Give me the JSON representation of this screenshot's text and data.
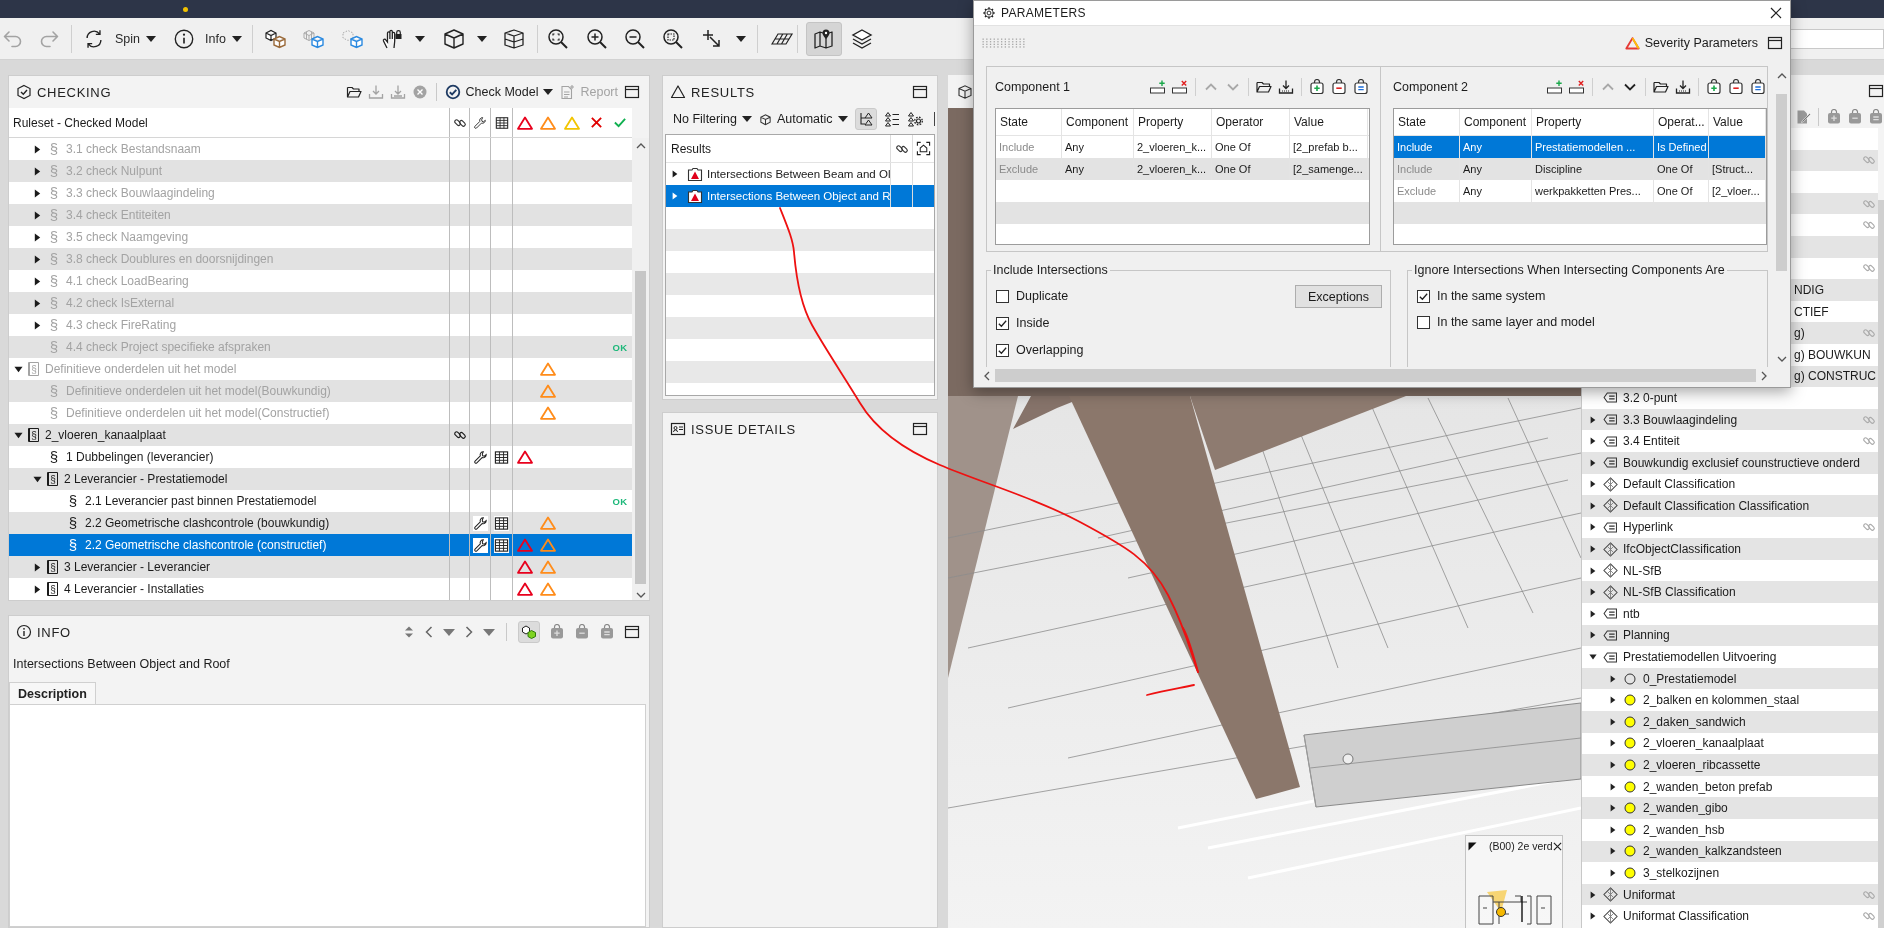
{
  "toolbar": {
    "undo": {
      "disabled": true
    },
    "redo": {
      "disabled": true
    },
    "spin": {
      "label": "Spin"
    },
    "info": {
      "label": "Info"
    },
    "map_view": {
      "active": true
    }
  },
  "checking": {
    "title": "CHECKING",
    "open_disabled": false,
    "import_disabled": true,
    "export_disabled": true,
    "stop_disabled": true,
    "check_model": "Check Model",
    "report": {
      "label": "Report",
      "disabled": true
    },
    "column_header": "Ruleset - Checked Model",
    "tree": [
      {
        "children": [
          {
            "kind": "rule",
            "symbol": "§",
            "label": "3.1 check Bestandsnaam",
            "enabled": false,
            "expanded": false,
            "selected": false
          },
          {
            "kind": "rule",
            "symbol": "§",
            "label": "3.2 check Nulpunt",
            "enabled": false,
            "expanded": false,
            "selected": false
          },
          {
            "kind": "rule",
            "symbol": "§",
            "label": "3.3 check Bouwlaagindeling",
            "enabled": false,
            "expanded": false,
            "selected": false
          },
          {
            "kind": "rule",
            "symbol": "§",
            "label": "3.4 check Entiteiten",
            "enabled": false,
            "expanded": false,
            "selected": false
          },
          {
            "kind": "rule",
            "symbol": "§",
            "label": "3.5 check Naamgeving",
            "enabled": false,
            "expanded": false,
            "selected": false
          },
          {
            "kind": "rule",
            "symbol": "§",
            "label": "3.8 check Doublures en doorsnijdingen",
            "enabled": false,
            "expanded": false,
            "selected": false
          },
          {
            "kind": "rule",
            "symbol": "§",
            "label": "4.1 check LoadBearing",
            "enabled": false,
            "expanded": false,
            "selected": false
          },
          {
            "kind": "rule",
            "symbol": "§",
            "label": "4.2 check IsExternal",
            "enabled": false,
            "expanded": false,
            "selected": false
          },
          {
            "kind": "rule",
            "symbol": "§",
            "label": "4.3 check FireRating",
            "enabled": false,
            "expanded": false,
            "selected": false
          },
          {
            "kind": "rule",
            "symbol": "§",
            "label": "4.4 check Project specifieke afspraken",
            "enabled": false,
            "selected": false,
            "status_text": "OK"
          }
        ]
      },
      {
        "kind": "ruleset",
        "symbol": "§",
        "label": "Definitieve onderdelen uit het model",
        "enabled": false,
        "expanded": true,
        "selected": false,
        "moderate": true,
        "children": [
          {
            "kind": "rule",
            "symbol": "§",
            "label": "Definitieve onderdelen uit het model(Bouwkundig)",
            "enabled": false,
            "selected": false,
            "moderate": true
          },
          {
            "kind": "rule",
            "symbol": "§",
            "label": "Definitieve onderdelen uit het model(Constructief)",
            "enabled": false,
            "selected": false,
            "moderate": true
          }
        ]
      },
      {
        "kind": "ruleset",
        "symbol": "§",
        "label": "2_vloeren_kanaalplaat",
        "enabled": true,
        "expanded": true,
        "selected": false,
        "link": true,
        "children": [
          {
            "kind": "rule",
            "symbol": "§",
            "label": "1 Dubbelingen (leverancier)",
            "enabled": true,
            "selected": false,
            "wrench": true,
            "table": true,
            "critical": true
          },
          {
            "kind": "ruleset",
            "symbol": "§",
            "label": "2 Leverancier - Prestatiemodel",
            "enabled": true,
            "expanded": true,
            "selected": false,
            "children": [
              {
                "kind": "rule",
                "symbol": "§",
                "label": "2.1 Leverancier past binnen Prestatiemodel",
                "enabled": true,
                "selected": false,
                "status_text": "OK"
              },
              {
                "kind": "rule",
                "symbol": "§",
                "label": "2.2 Geometrische clashcontrole (bouwkundig)",
                "enabled": true,
                "selected": false,
                "wrench": true,
                "table": true,
                "moderate": true
              },
              {
                "kind": "rule",
                "symbol": "§",
                "label": "2.2 Geometrische clashcontrole (constructief)",
                "enabled": true,
                "selected": true,
                "wrench": true,
                "table": true,
                "critical": true,
                "moderate": true
              }
            ]
          },
          {
            "kind": "ruleset",
            "symbol": "§",
            "label": "3 Leverancier - Leverancier",
            "enabled": true,
            "expanded": false,
            "selected": false,
            "critical": true,
            "moderate": true
          },
          {
            "kind": "ruleset",
            "symbol": "§",
            "label": "4 Leverancier - Installaties",
            "enabled": true,
            "expanded": false,
            "selected": false,
            "critical": true,
            "moderate": true
          }
        ]
      }
    ]
  },
  "info": {
    "title": "INFO",
    "show_model_active": true,
    "heading": "Intersections Between Object and Roof",
    "tabs": [
      {
        "label": "Description",
        "selected": true
      }
    ]
  },
  "results": {
    "title": "RESULTS",
    "filter": "No Filtering",
    "mode": "Automatic",
    "tree_view_active": true,
    "column_header": "Results",
    "rows": [
      {
        "label": "Intersections Between Beam and Ol",
        "expanded": false,
        "selected": false
      },
      {
        "label": "Intersections Between Object and R",
        "expanded": false,
        "selected": true
      }
    ]
  },
  "issue_details": {
    "title": "ISSUE DETAILS"
  },
  "viewport": {
    "view_label": "(B00) 2e verd"
  },
  "properties": {
    "covered_rows": [
      {},
      {
        "link": true
      },
      {},
      {
        "link": true
      },
      {
        "link": true
      },
      {},
      {
        "link": true
      },
      {
        "tail": "NDIG"
      },
      {
        "tail": "CTIEF"
      },
      {
        "tail": "g)",
        "link": true
      },
      {
        "tail": "g) BOUWKUN"
      },
      {
        "tail": "g) CONSTRUC"
      }
    ],
    "tree": [
      {
        "kind": "property",
        "label": "3.2 0-punt"
      },
      {
        "kind": "property",
        "label": "3.3 Bouwlaagindeling",
        "expanded": false,
        "link": true
      },
      {
        "kind": "property",
        "label": "3.4 Entiteit",
        "expanded": false,
        "link": true
      },
      {
        "kind": "property",
        "label": "Bouwkundig exclusief counstructieve onderd",
        "expanded": false
      },
      {
        "kind": "classification",
        "label": "Default Classification",
        "expanded": false
      },
      {
        "kind": "classification",
        "label": "Default Classification Classification",
        "expanded": false
      },
      {
        "kind": "property",
        "label": "Hyperlink",
        "expanded": false,
        "link": true
      },
      {
        "kind": "classification",
        "label": "IfcObjectClassification",
        "expanded": false
      },
      {
        "kind": "classification",
        "label": "NL-SfB",
        "expanded": false
      },
      {
        "kind": "classification",
        "label": "NL-SfB Classification",
        "expanded": false
      },
      {
        "kind": "property",
        "label": "ntb",
        "expanded": false
      },
      {
        "kind": "property",
        "label": "Planning",
        "expanded": false
      },
      {
        "kind": "property",
        "label": "Prestatiemodellen Uitvoering",
        "expanded": true,
        "children": [
          {
            "kind": "value",
            "label": "0_Prestatiemodel",
            "expanded": false
          },
          {
            "kind": "value",
            "label": "2_balken en kolommen_staal",
            "expanded": false,
            "color": "#ffff00"
          },
          {
            "kind": "value",
            "label": "2_daken_sandwich",
            "expanded": false,
            "color": "#ffff00"
          },
          {
            "kind": "value",
            "label": "2_vloeren_kanaalplaat",
            "expanded": false,
            "color": "#ffff00"
          },
          {
            "kind": "value",
            "label": "2_vloeren_ribcassette",
            "expanded": false,
            "color": "#ffff00"
          },
          {
            "kind": "value",
            "label": "2_wanden_beton prefab",
            "expanded": false,
            "color": "#ffff00"
          },
          {
            "kind": "value",
            "label": "2_wanden_gibo",
            "expanded": false,
            "color": "#ffff00"
          },
          {
            "kind": "value",
            "label": "2_wanden_hsb",
            "expanded": false,
            "color": "#ffff00"
          },
          {
            "kind": "value",
            "label": "2_wanden_kalkzandsteen",
            "expanded": false,
            "color": "#ffff00"
          },
          {
            "kind": "value",
            "label": "3_stelkozijnen",
            "expanded": false,
            "color": "#ffff00"
          }
        ]
      },
      {
        "kind": "classification",
        "label": "Uniformat",
        "expanded": false,
        "link": true
      },
      {
        "kind": "classification",
        "label": "Uniformat Classification",
        "expanded": false,
        "link": true
      }
    ]
  },
  "parameters_dialog": {
    "title": "PARAMETERS",
    "severity_label": "Severity Parameters",
    "components": [
      {
        "title": "Component 1",
        "move_up_enabled": false,
        "move_down_enabled": false,
        "columns": [
          "State",
          "Component",
          "Property",
          "Operator",
          "Value"
        ],
        "rows": [
          {
            "state": "Include",
            "component": "Any",
            "property": "2_vloeren_k...",
            "operator": "One Of",
            "value": "[2_prefab b...",
            "selected": false
          },
          {
            "state": "Exclude",
            "component": "Any",
            "property": "2_vloeren_k...",
            "operator": "One Of",
            "value": "[2_samenge...",
            "selected": false
          }
        ]
      },
      {
        "title": "Component 2",
        "move_up_enabled": false,
        "move_down_enabled": true,
        "columns": [
          "State",
          "Component",
          "Property",
          "Operat...",
          "Value"
        ],
        "rows": [
          {
            "state": "Include",
            "component": "Any",
            "property": "Prestatiemodellen ...",
            "operator": "Is Defined",
            "selected": true
          },
          {
            "state": "Include",
            "component": "Any",
            "property": "Discipline",
            "operator": "One Of",
            "value": "[Struct...",
            "selected": false
          },
          {
            "state": "Exclude",
            "component": "Any",
            "property": "werkpakketten Pres...",
            "operator": "One Of",
            "value": "[2_vloer...",
            "selected": false
          }
        ]
      }
    ],
    "include_intersections": {
      "title": "Include Intersections",
      "options": [
        {
          "label": "Duplicate",
          "checked": false
        },
        {
          "label": "Inside",
          "checked": true
        },
        {
          "label": "Overlapping",
          "checked": true
        }
      ],
      "exceptions_button": "Exceptions"
    },
    "ignore_intersections": {
      "title": "Ignore Intersections When Intersecting Components Are",
      "options": [
        {
          "label": "In the same system",
          "checked": true
        },
        {
          "label": "In the same layer and model",
          "checked": false
        }
      ]
    }
  }
}
